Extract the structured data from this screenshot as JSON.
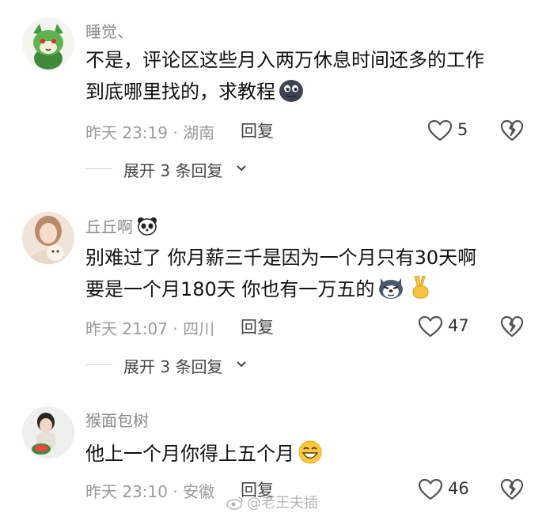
{
  "comments": [
    {
      "username": "睡觉、",
      "text_lines": [
        "不是，评论区这些月入两万休息时间还多的工作",
        "到底哪里找的，求教程"
      ],
      "meta": "昨天 23:19 · 湖南",
      "reply_label": "回复",
      "likes": "5",
      "expand_label": "展开 3 条回复",
      "avatar_icon": "green-cat-avatar",
      "emoji_icon": "dark-blob-emoji"
    },
    {
      "username": "丘丘啊",
      "text_lines": [
        "别难过了 你月薪三千是因为一个月只有30天啊",
        "要是一个月180天 你也有一万五的"
      ],
      "meta": "昨天 21:07 · 四川",
      "reply_label": "回复",
      "likes": "47",
      "expand_label": "展开 3 条回复",
      "avatar_icon": "girl-with-dog-avatar",
      "badge_icon": "panda-badge-icon",
      "emoji_icon": "husky-emoji"
    },
    {
      "username": "猴面包树",
      "text_lines": [
        "他上一个月你得上五个月"
      ],
      "meta": "昨天 23:10 · 安徽",
      "reply_label": "回复",
      "likes": "46",
      "avatar_icon": "child-avatar",
      "emoji_icon": "grin-emoji"
    }
  ],
  "watermark": "@老王夫插",
  "colors": {
    "meta_gray": "#9a9a9a",
    "text": "#111111",
    "username_gray": "#8a8a8a"
  }
}
